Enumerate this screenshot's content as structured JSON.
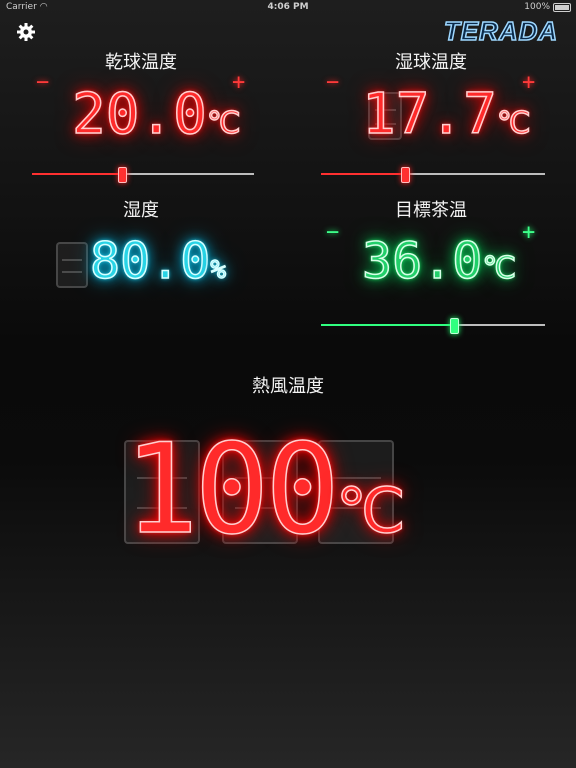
{
  "status_bar": {
    "carrier": "Carrier",
    "time": "4:06 PM",
    "battery": "100%"
  },
  "app": {
    "logo": "TERADA"
  },
  "dry_bulb": {
    "label": "乾球温度",
    "value": "20.0",
    "unit": "℃",
    "minus": "−",
    "plus": "+",
    "slider": 0.4
  },
  "wet_bulb": {
    "label": "湿球温度",
    "value": "17.7",
    "unit": "℃",
    "minus": "−",
    "plus": "+",
    "slider": 0.37
  },
  "humidity": {
    "label": "湿度",
    "value": "80.0",
    "unit": "%"
  },
  "target_tea": {
    "label": "目標茶温",
    "value": "36.0",
    "unit": "℃",
    "minus": "−",
    "plus": "+",
    "slider": 0.59
  },
  "hot_air": {
    "label": "熱風温度",
    "value": "100",
    "unit": "℃"
  },
  "colors": {
    "red": "#ff2a2a",
    "cyan": "#29d4e6",
    "green": "#22d06a",
    "track": "#bdbdbd"
  }
}
